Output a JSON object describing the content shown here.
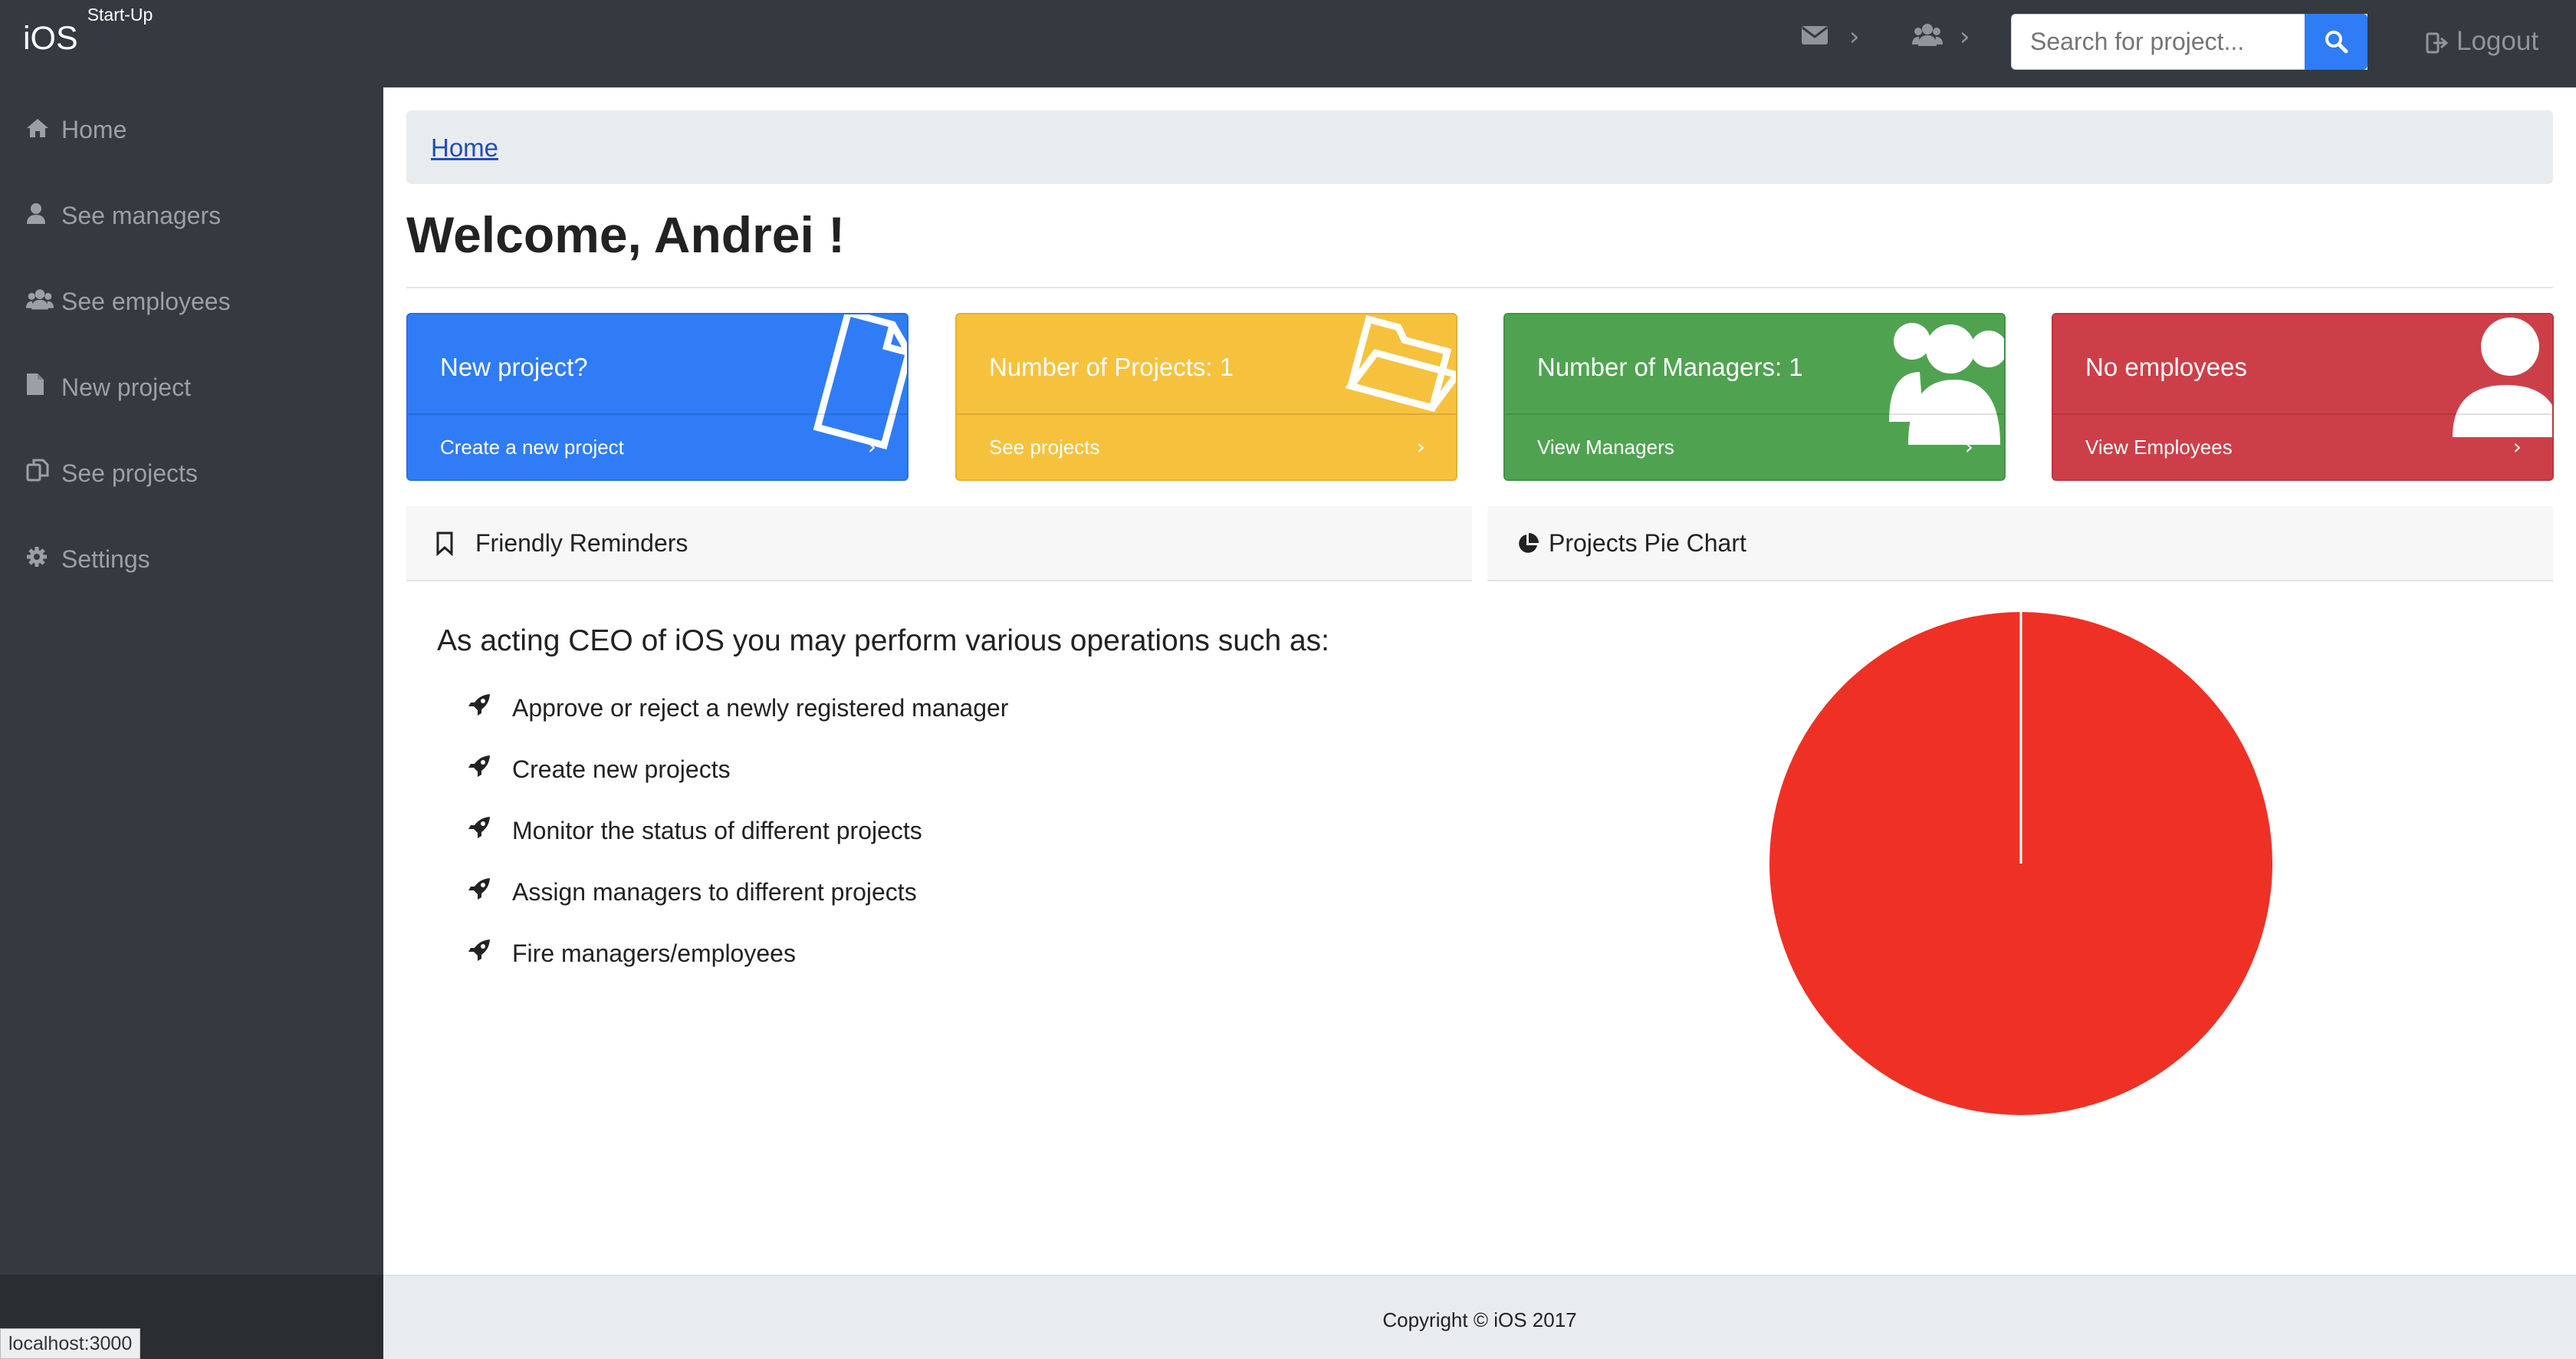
{
  "app": {
    "brand": "iOS",
    "brand_sup": "Start-Up"
  },
  "topbar": {
    "search_placeholder": "Search for project...",
    "logout_label": "Logout",
    "mail_icon": "envelope-icon",
    "team_icon": "users-icon"
  },
  "sidebar": {
    "items": [
      {
        "label": "Home",
        "icon": "home-icon"
      },
      {
        "label": "See managers",
        "icon": "user-icon"
      },
      {
        "label": "See employees",
        "icon": "users-icon"
      },
      {
        "label": "New project",
        "icon": "file-icon"
      },
      {
        "label": "See projects",
        "icon": "copy-icon"
      },
      {
        "label": "Settings",
        "icon": "gear-icon"
      }
    ]
  },
  "breadcrumb": {
    "home": "Home"
  },
  "welcome": "Welcome, Andrei !",
  "cards": [
    {
      "title": "New project?",
      "link": "Create a new project",
      "color": "#2f7cf6",
      "icon": "file-icon"
    },
    {
      "title": "Number of Projects: 1",
      "link": "See projects",
      "color": "#f6c23e",
      "icon": "folder-open-icon"
    },
    {
      "title": "Number of Managers: 1",
      "link": "View Managers",
      "color": "#4fa350",
      "icon": "users-icon"
    },
    {
      "title": "No employees",
      "link": "View Employees",
      "color": "#cd3f48",
      "icon": "user-icon"
    }
  ],
  "reminders": {
    "title": "Friendly Reminders",
    "lead": "As acting CEO of iOS you may perform various operations such as:",
    "items": [
      "Approve or reject a newly registered manager",
      "Create new projects",
      "Monitor the status of different projects",
      "Assign managers to different projects",
      "Fire managers/employees"
    ]
  },
  "pie_panel": {
    "title": "Projects Pie Chart"
  },
  "chart_data": {
    "type": "pie",
    "values": [
      1
    ],
    "colors": [
      "#ee3124"
    ]
  },
  "footer": {
    "copyright": "Copyright © iOS 2017"
  },
  "status_url": "localhost:3000"
}
